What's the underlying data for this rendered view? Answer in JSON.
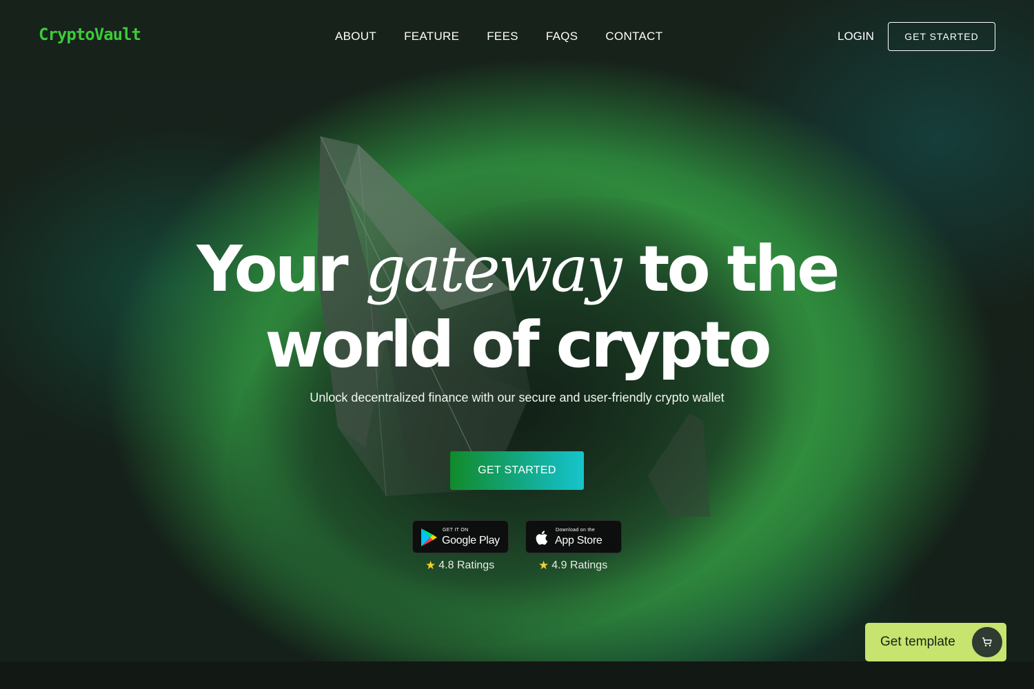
{
  "brand": {
    "logo": "CryptoVault",
    "accent_color": "#3ec93a"
  },
  "nav": {
    "links": [
      "ABOUT",
      "FEATURE",
      "FEES",
      "FAQS",
      "CONTACT"
    ],
    "login": "LOGIN",
    "cta": "GET STARTED"
  },
  "hero": {
    "headline_part1": "Your ",
    "headline_italic": "gateway",
    "headline_part2": " to the",
    "headline_line2": "world of crypto",
    "subtitle": "Unlock decentralized finance with our secure and user-friendly crypto wallet",
    "cta": "GET STARTED"
  },
  "stores": {
    "google_play": {
      "small": "GET IT ON",
      "big": "Google Play",
      "icon": "google-play-icon",
      "rating": "4.8 Ratings"
    },
    "app_store": {
      "small": "Download on the",
      "big": "App Store",
      "icon": "apple-icon",
      "rating": "4.9 Ratings"
    }
  },
  "template_button": {
    "label": "Get template",
    "icon": "cart-icon",
    "color": "#c6e46e"
  }
}
